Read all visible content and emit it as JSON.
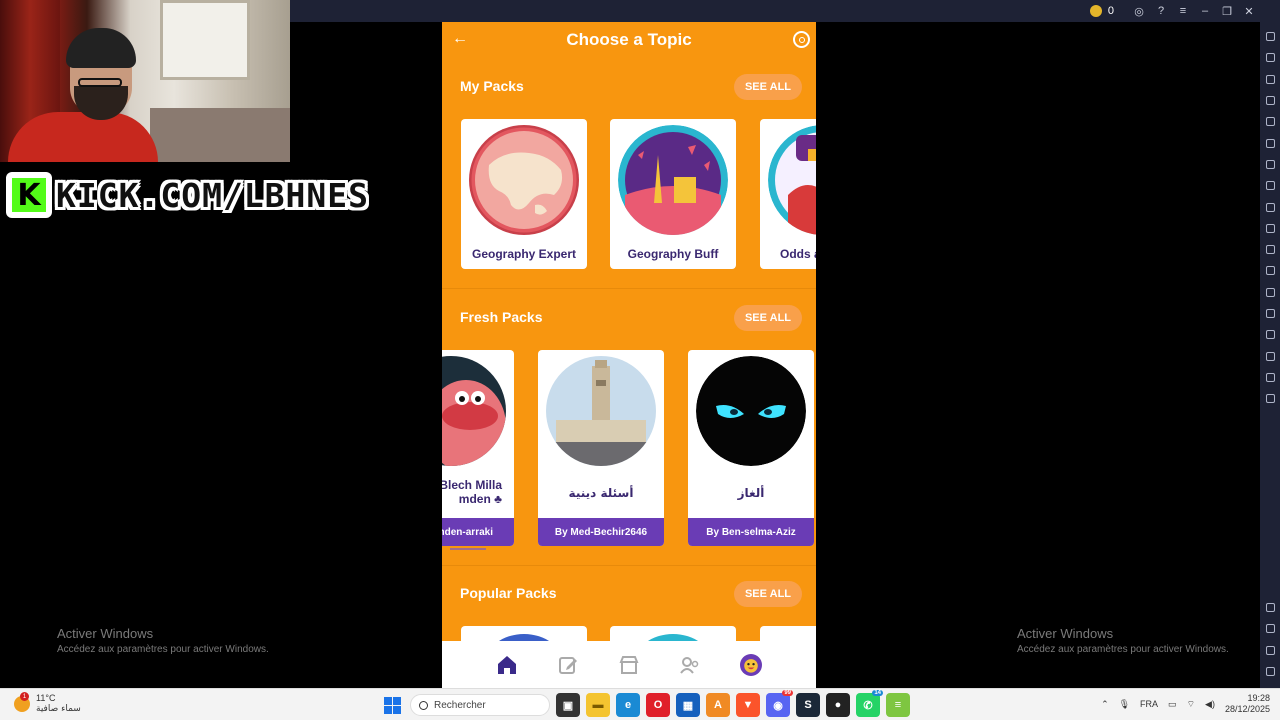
{
  "emulator": {
    "coin_count": "0"
  },
  "overlay": {
    "kick_logo_letter": "K",
    "kick_text": "KICK.COM/LBHNES"
  },
  "app": {
    "title": "Choose a Topic",
    "sections": {
      "my_packs": {
        "title": "My Packs",
        "see_all": "SEE ALL",
        "cards": [
          {
            "label": "Geography Expert"
          },
          {
            "label": "Geography Buff"
          },
          {
            "label": "Odds a"
          }
        ]
      },
      "fresh_packs": {
        "title": "Fresh Packs",
        "see_all": "SEE ALL",
        "cards": [
          {
            "label": "Blech Milla\nmden ♣",
            "by": "nden-arraki"
          },
          {
            "label": "أسئلة دينية",
            "by": "By Med-Bechir2646"
          },
          {
            "label": "ألغاز",
            "by": "By Ben-selma-Aziz"
          }
        ]
      },
      "popular_packs": {
        "title": "Popular Packs",
        "see_all": "SEE ALL"
      }
    },
    "nav": [
      "home-icon",
      "edit-icon",
      "shop-icon",
      "friends-icon",
      "profile-avatar"
    ]
  },
  "watermark": {
    "line1": "Activer Windows",
    "line2": "Accédez aux paramètres pour activer Windows."
  },
  "taskbar": {
    "weather_badge": "1",
    "temperature": "11°C",
    "weather_desc": "سماء صافية",
    "search_placeholder": "Rechercher",
    "language": "FRA",
    "time": "19:28",
    "date": "28/12/2025",
    "discord_badge": "99",
    "whatsapp_badge": "14"
  }
}
